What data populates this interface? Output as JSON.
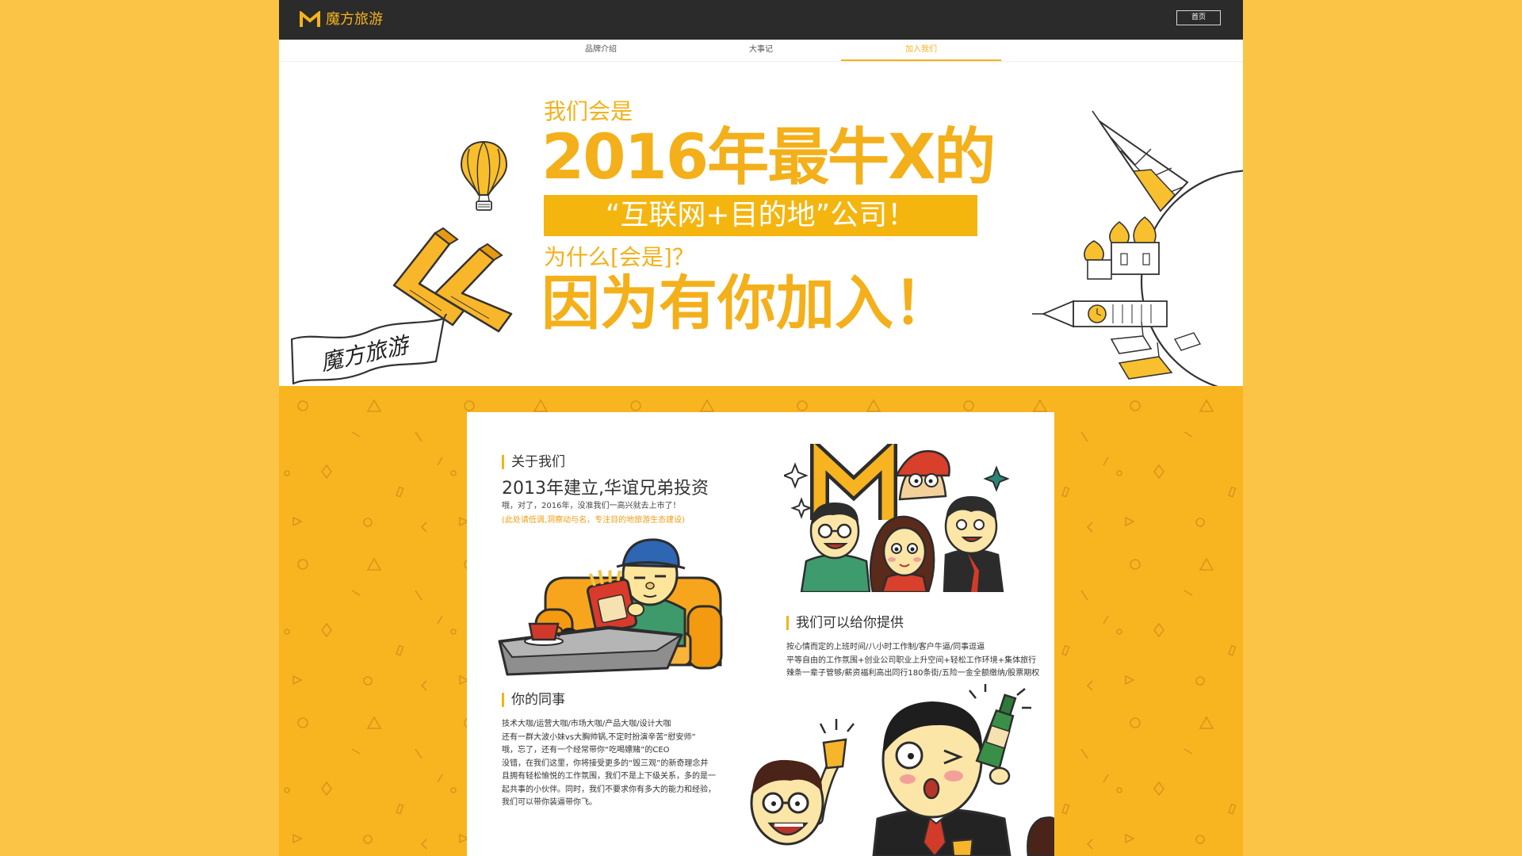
{
  "app": {
    "logo_text": "魔方旅游",
    "home_button": "首页"
  },
  "nav": {
    "tabs": [
      {
        "label": "品牌介绍",
        "active": false
      },
      {
        "label": "大事记",
        "active": false
      },
      {
        "label": "加入我们",
        "active": true
      }
    ]
  },
  "hero": {
    "line1": "我们会是",
    "line2": "2016年最牛X的",
    "highlight": "“互联网+目的地”公司！",
    "question": "为什么[会是]？",
    "answer": "因为有你加入！",
    "banner_text": "魔方旅游"
  },
  "about": {
    "heading": "关于我们",
    "subtitle": "2013年建立,华谊兄弟投资",
    "note": "哦，对了，2016年，没准我们一高兴就去上市了！",
    "aside": "(此处请低调,洞察动与名，专注目的地旅游生态建设)"
  },
  "colleagues": {
    "heading": "你的同事",
    "lines": [
      "技术大咖/运营大咖/市场大咖/产品大咖/设计大咖",
      "还有一群大波小妹vs大胸帅锅,不定时扮演辛苦“慰安师”",
      "哦，忘了，还有一个经常带你“吃喝嫖赌”的CEO",
      "没错，在我们这里，你将接受更多的“毁三观”的新奇理念并",
      "且拥有轻松愉悦的工作氛围，我们不是上下级关系，多的是一",
      "起共事的小伙伴。同时，我们不要求你有多大的能力和经验，",
      "我们可以带你装逼带你飞。"
    ]
  },
  "offer": {
    "heading": "我们可以给你提供",
    "lines": [
      "按心情而定的上班时间/八小时工作制/客户牛逼/同事逗逼",
      "平等自由的工作氛围+创业公司职业上升空间+轻松工作环境+集体旅行",
      "辣条一辈子管够/薪资福利高出同行180条街/五险一金全额缴纳/股票期权"
    ]
  },
  "icons": {
    "logo": "logo-m-icon",
    "balloon": "hot-air-balloon-icon",
    "arrows": "zigzag-arrow-icon",
    "globe": "landmark-globe-icon"
  },
  "colors": {
    "page_bg": "#FCC447",
    "section_bg": "#F8B520",
    "accent": "#F5B21C",
    "topbar": "#2B2B2B",
    "card": "#FFFFFF"
  }
}
